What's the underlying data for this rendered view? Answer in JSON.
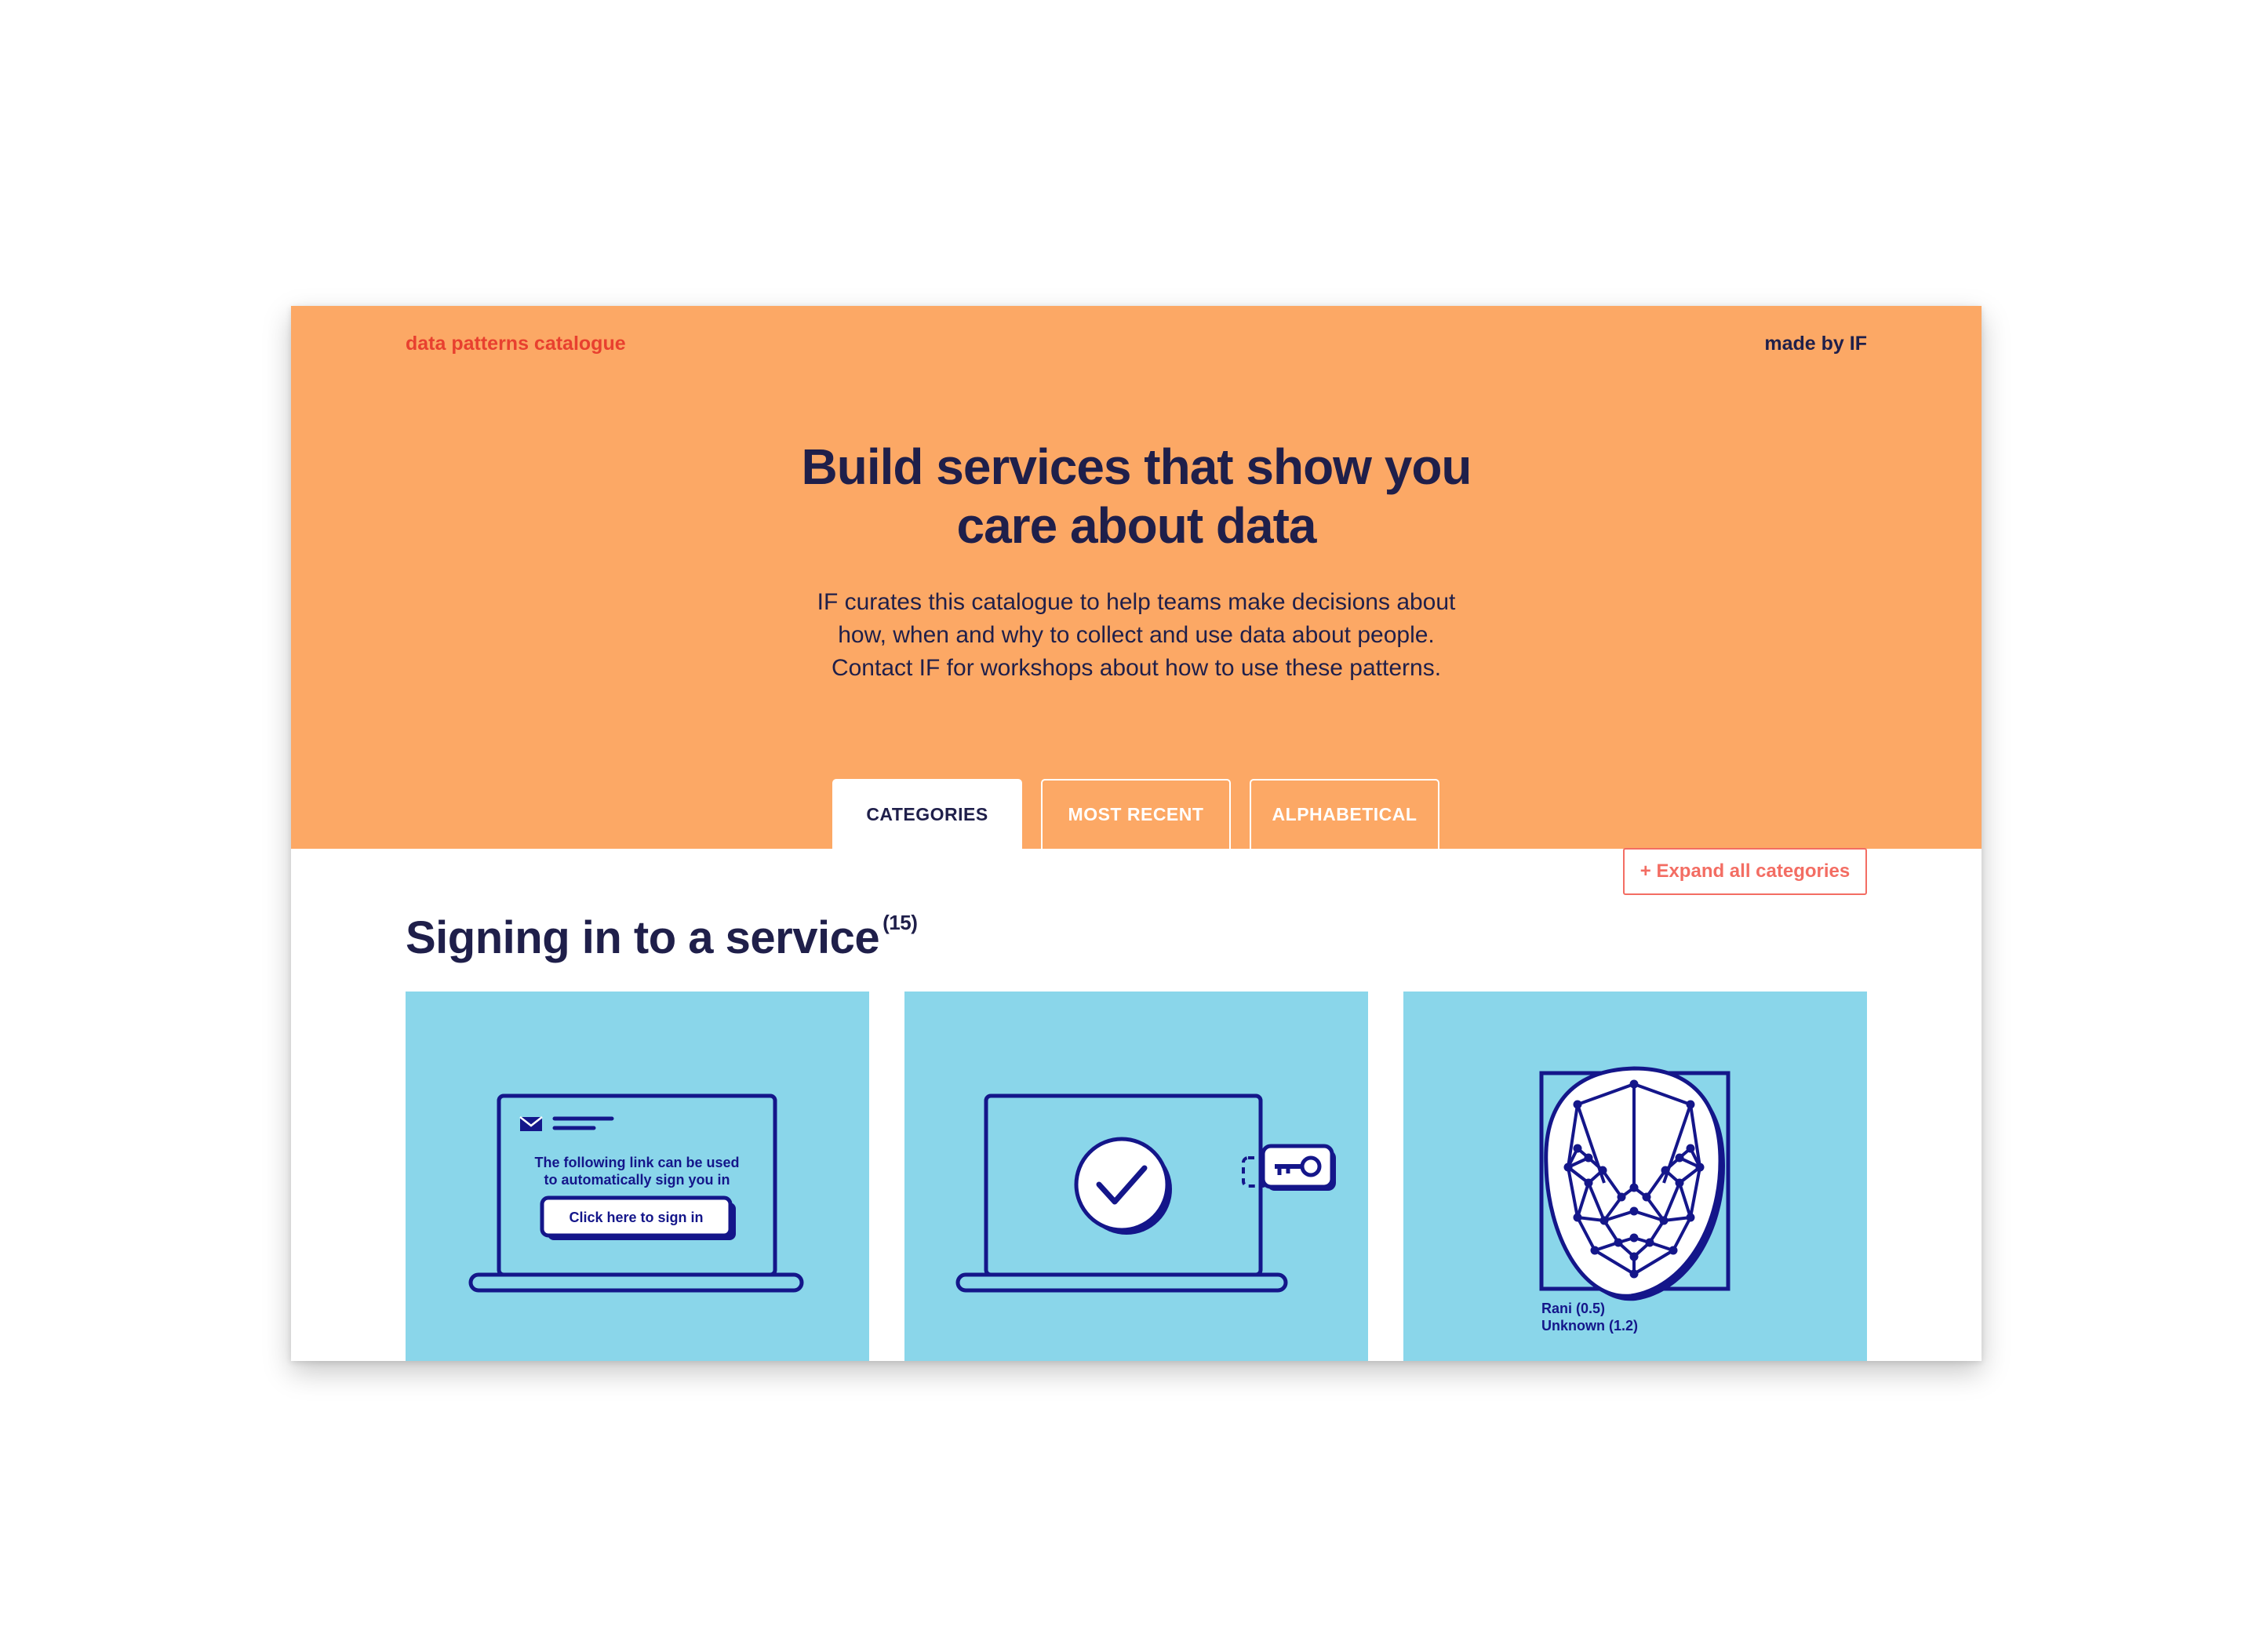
{
  "header": {
    "brand": "data patterns catalogue",
    "maker": "made by IF"
  },
  "hero": {
    "headline_line1": "Build services that show you",
    "headline_line2": "care about data",
    "intro_lines": [
      "IF curates this catalogue to help teams make decisions about",
      "how, when and why to collect and use data about people.",
      "Contact IF for workshops about how to use these patterns."
    ]
  },
  "tabs": [
    {
      "label": "CATEGORIES",
      "active": true
    },
    {
      "label": "MOST RECENT",
      "active": false
    },
    {
      "label": "ALPHABETICAL",
      "active": false
    }
  ],
  "expand_button": "+ Expand all categories",
  "section": {
    "title": "Signing in to a service",
    "count": "(15)"
  },
  "cards": [
    {
      "illustration": "laptop-email-magic-link",
      "email_line1": "The following link can be used",
      "email_line2": "to automatically sign you in",
      "button_label": "Click here to sign in"
    },
    {
      "illustration": "laptop-check-security-key"
    },
    {
      "illustration": "face-recognition",
      "match_line1": "Rani (0.5)",
      "match_line2": "Unknown (1.2)"
    }
  ],
  "colors": {
    "hero_background": "#fca865",
    "brand": "#e8402f",
    "navy": "#1f1f4a",
    "card_background": "#8ad6ea",
    "illustration_stroke": "#14168a",
    "accent_button": "#f36d63"
  }
}
